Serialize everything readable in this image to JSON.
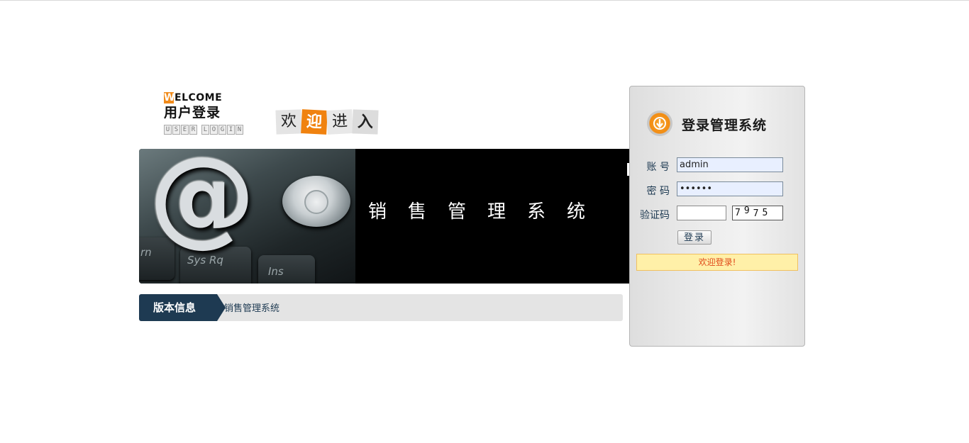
{
  "header": {
    "welcome_first": "W",
    "welcome_rest": "ELCOME",
    "user_login_cn": "用户登录",
    "user_login_en": [
      "U",
      "S",
      "E",
      "R",
      "",
      "L",
      "O",
      "G",
      "I",
      "N"
    ],
    "welcome_chars": [
      "欢",
      "迎",
      "进",
      "入"
    ]
  },
  "banner": {
    "title": "销售管理系统",
    "keys": [
      "rn",
      "Sys Rq",
      "Ins"
    ]
  },
  "version": {
    "tag": "版本信息",
    "text": "销售管理系统"
  },
  "login": {
    "title": "登录管理系统",
    "username_label": "账 号",
    "username_value": "admin",
    "password_label": "密 码",
    "password_value": "••••••",
    "captcha_label": "验证码",
    "captcha_input_value": "",
    "captcha_chars": [
      "7",
      "9",
      "7",
      "5"
    ],
    "submit_label": "登录",
    "message": "欢迎登录!"
  },
  "colors": {
    "accent_orange": "#f08a1a",
    "navy": "#1e3a52",
    "message_bg": "#fff0a8",
    "message_text": "#e04a1a"
  }
}
